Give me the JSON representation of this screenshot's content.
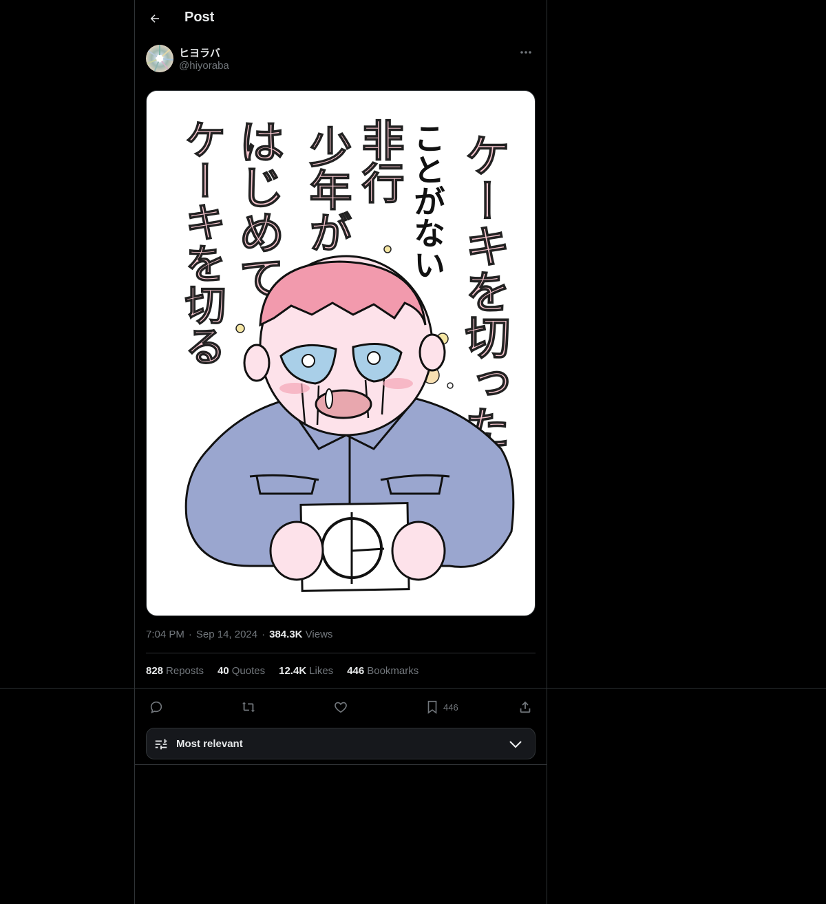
{
  "header": {
    "title": "Post"
  },
  "author": {
    "name": "ヒヨラバ",
    "handle": "@hiyoraba"
  },
  "illustration": {
    "lines": [
      "ケーキを切った",
      "ことがない",
      "非行",
      "少年が",
      "はじめて",
      "ケーキを切る"
    ]
  },
  "meta": {
    "time": "7:04 PM",
    "date": "Sep 14, 2024",
    "views_count": "384.3K",
    "views_label": "Views",
    "separator": "·"
  },
  "stats": {
    "reposts": {
      "count": "828",
      "label": "Reposts"
    },
    "quotes": {
      "count": "40",
      "label": "Quotes"
    },
    "likes": {
      "count": "12.4K",
      "label": "Likes"
    },
    "bookmarks": {
      "count": "446",
      "label": "Bookmarks"
    }
  },
  "actions": {
    "bookmark_count": "446"
  },
  "sort": {
    "label": "Most relevant"
  },
  "colors": {
    "background": "#000000",
    "text": "#e7e9ea",
    "muted": "#71767b",
    "border": "#2f3336",
    "pink": "#f7c6cf",
    "jacket": "#9aa6cf"
  }
}
